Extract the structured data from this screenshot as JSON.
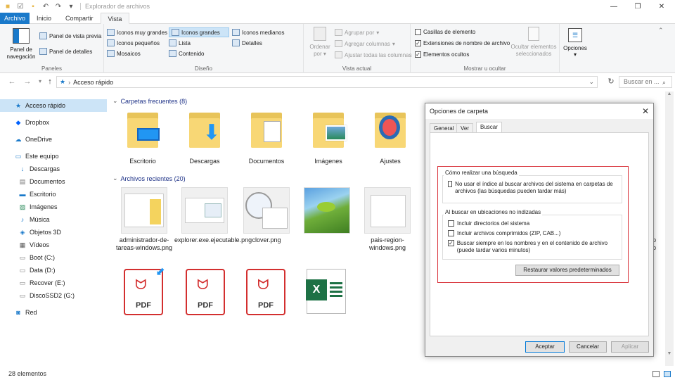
{
  "window": {
    "title": "Explorador de archivos"
  },
  "tabs": [
    {
      "label": "Archivo"
    },
    {
      "label": "Inicio"
    },
    {
      "label": "Compartir"
    },
    {
      "label": "Vista"
    }
  ],
  "ribbon": {
    "paneles": {
      "label": "Paneles",
      "panel_nav": "Panel de navegación",
      "vista_previa": "Panel de vista previa",
      "detalles": "Panel de detalles"
    },
    "diseno": {
      "label": "Diseño",
      "items": [
        "Iconos muy grandes",
        "Iconos grandes",
        "Iconos medianos",
        "Iconos pequeños",
        "Lista",
        "Detalles",
        "Mosaicos",
        "Contenido"
      ]
    },
    "vista_actual": {
      "label": "Vista actual",
      "ordenar": "Ordenar por",
      "agrupar": "Agrupar por",
      "agregar_columnas": "Agregar columnas",
      "ajustar": "Ajustar todas las columnas"
    },
    "mostrar": {
      "label": "Mostrar u ocultar",
      "casillas": "Casillas de elemento",
      "extensiones": "Extensiones de nombre de archivo",
      "ocultos": "Elementos ocultos",
      "ocultar_sel": "Ocultar elementos seleccionados",
      "opciones": "Opciones"
    }
  },
  "address": {
    "path": "Acceso rápido",
    "search_placeholder": "Buscar en ..."
  },
  "nav": [
    {
      "label": "Acceso rápido"
    },
    {
      "label": "Dropbox"
    },
    {
      "label": "OneDrive"
    },
    {
      "label": "Este equipo"
    },
    {
      "label": "Descargas"
    },
    {
      "label": "Documentos"
    },
    {
      "label": "Escritorio"
    },
    {
      "label": "Imágenes"
    },
    {
      "label": "Música"
    },
    {
      "label": "Objetos 3D"
    },
    {
      "label": "Vídeos"
    },
    {
      "label": "Boot (C:)"
    },
    {
      "label": "Data (D:)"
    },
    {
      "label": "Recover (E:)"
    },
    {
      "label": "DiscoSSD2 (G:)"
    },
    {
      "label": "Red"
    }
  ],
  "content": {
    "frecuentes_header": "Carpetas frecuentes (8)",
    "recientes_header": "Archivos recientes (20)",
    "folders": [
      {
        "label": "Escritorio"
      },
      {
        "label": "Descargas"
      },
      {
        "label": "Documentos"
      },
      {
        "label": "Imágenes"
      },
      {
        "label": "Ajustes"
      }
    ],
    "recent": [
      {
        "label": "administrador-de-tareas-windows.png"
      },
      {
        "label": "explorer.exe.ejecutable.png"
      },
      {
        "label": "clover.png"
      },
      {
        "label": ""
      },
      {
        "label": "pais-region-windows.png"
      }
    ],
    "pdf_label": "PDF"
  },
  "status": {
    "count": "28 elementos"
  },
  "dialog": {
    "title": "Opciones de carpeta",
    "tabs": [
      "General",
      "Ver",
      "Buscar"
    ],
    "group1": {
      "title": "Cómo realizar una búsqueda",
      "opt1": "No usar el índice al buscar archivos del sistema en carpetas de archivos (las búsquedas pueden tardar más)"
    },
    "group2": {
      "title": "Al buscar en ubicaciones no indizadas",
      "opt1": "Incluir directorios del sistema",
      "opt2": "Incluir archivos comprimidos (ZIP, CAB...)",
      "opt3": "Buscar siempre en los nombres y en el contenido de archivo (puede tardar varios minutos)"
    },
    "restore": "Restaurar valores predeterminados",
    "ok": "Aceptar",
    "cancel": "Cancelar",
    "apply": "Aplicar"
  },
  "colors": {
    "accent": "#1979ca",
    "folder": "#f8d775",
    "highlight": "#d9363e"
  }
}
